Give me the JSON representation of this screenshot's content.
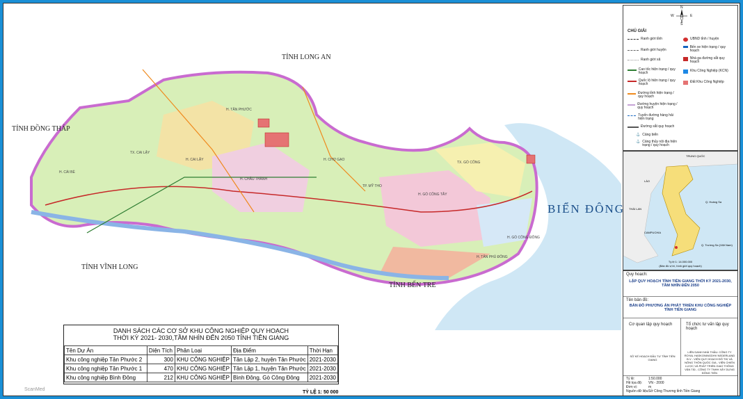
{
  "map": {
    "sea_label": "BIỂN ĐÔNG",
    "neighbors": [
      {
        "id": "long-an",
        "text": "TỈNH LONG AN"
      },
      {
        "id": "dong-thap",
        "text": "TỈNH ĐỒNG THÁP"
      },
      {
        "id": "vinh-long",
        "text": "TỈNH VĨNH LONG"
      },
      {
        "id": "ben-tre",
        "text": "TỈNH BẾN TRE"
      }
    ],
    "districts": [
      "H. CÁI BÈ",
      "H. CAI LẬY",
      "H. TÂN PHƯỚC",
      "TX. CAI LẬY",
      "H. CHÂU THÀNH",
      "TP. MỸ THO",
      "H. CHỢ GẠO",
      "H. GÒ CÔNG TÂY",
      "H. GÒ CÔNG ĐÔNG",
      "TX. GÒ CÔNG",
      "H. TÂN PHÚ ĐÔNG"
    ],
    "scale": "TỶ LỆ 1: 50 000",
    "watermark": "ScanMed"
  },
  "legend": {
    "compass": {
      "n": "N",
      "s": "S",
      "e": "E",
      "w": "W"
    },
    "title": "CHÚ GIẢI",
    "left_items": [
      {
        "id": "ranh-gioi-tinh",
        "label": "Ranh giới tỉnh",
        "color": "#333",
        "style": "dashed"
      },
      {
        "id": "ranh-gioi-huyen",
        "label": "Ranh giới huyện",
        "color": "#666",
        "style": "dashed"
      },
      {
        "id": "ranh-gioi-xa",
        "label": "Ranh giới xã",
        "color": "#999",
        "style": "dotted"
      },
      {
        "id": "cao-toc",
        "label": "Cao tốc hiện trạng / quy hoạch",
        "color": "#2e7d32",
        "style": "solid"
      },
      {
        "id": "quoc-lo",
        "label": "Quốc lộ hiện trạng / quy hoạch",
        "color": "#c62828",
        "style": "solid"
      },
      {
        "id": "duong-tinh",
        "label": "Đường tỉnh hiện trạng / quy hoạch",
        "color": "#ef8a1e",
        "style": "solid"
      },
      {
        "id": "duong-huyen",
        "label": "Đường huyện hiện trạng / quy hoạch",
        "color": "#c5a3d6",
        "style": "solid"
      },
      {
        "id": "hang-hai",
        "label": "Tuyến đường hàng hải hiện trạng",
        "color": "#1565c0",
        "style": "dashed"
      },
      {
        "id": "duong-sat",
        "label": "Đường sắt quy hoạch",
        "color": "#555",
        "style": "solid"
      }
    ],
    "bottom_items": [
      {
        "id": "cang-bien",
        "label": "Cảng biển"
      },
      {
        "id": "cang-thuy",
        "label": "Cảng thủy nội địa hiện trạng / quy hoạch"
      }
    ],
    "right_items": [
      {
        "id": "ubnd",
        "label": "UBND tỉnh / huyện",
        "color": "#d32f2f"
      },
      {
        "id": "ben-xe",
        "label": "Bến xe hiện trạng / quy hoạch",
        "color": "#1565c0"
      },
      {
        "id": "nha-ga",
        "label": "Nhà ga đường sắt quy hoạch",
        "color": "#c62828"
      },
      {
        "id": "kcn",
        "label": "Khu Công Nghiệp (KCN)",
        "color": "#1e88e5"
      },
      {
        "id": "dat-kcn",
        "label": "Đất Khu Công Nghiệp",
        "color": "#e57373"
      }
    ]
  },
  "inset": {
    "labels": [
      "TRUNG QUỐC",
      "LÀO",
      "THÁI LAN",
      "CAMPUCHIA",
      "Q. Hoàng Sa",
      "Q. Trường Sa (Việt Nam)"
    ],
    "caption1": "Tỷ lệ 1: 14.000.000",
    "caption2": "(Bản đồ vị trí, hình giới quy hoạch)"
  },
  "info": {
    "quy_hoach_label": "Quy hoạch:",
    "quy_hoach_title": "LẬP QUY HOẠCH TỈNH TIỀN GIANG THỜI KỲ 2021-2030, TẦM NHÌN ĐẾN 2050",
    "ten_ban_do_label": "Tên bản đồ:",
    "ten_ban_do": "BẢN ĐỒ PHƯƠNG ÁN PHÁT TRIỂN KHU CÔNG NGHIỆP TỈNH TIỀN GIANG",
    "co_quan_label": "Cơ quan lập quy hoạch",
    "to_chuc_label": "Tổ chức tư vấn lập quy hoạch",
    "co_quan_value": "SỞ KẾ HOẠCH ĐẦU TƯ TỈNH TIỀN GIANG",
    "to_chuc_value": "LIÊN DANH NHÀ THẦU: CÔNG TY ROYAL HASKONINGDHV NEDERLAND B.V - VIỆN QUY HOẠCH ĐÔ THỊ VÀ NÔNG THÔN QUỐC GIA - VIỆN CHIẾN LƯỢC VÀ PHÁT TRIỂN GIAO THÔNG VẬN TẢI - CÔNG TY TNHH XÂY DỰNG ĐÔNG TIẾN",
    "ty_le_k": "Tỷ lệ:",
    "ty_le_v": "1:50.000",
    "he_toa_do_k": "Hệ tọa độ:",
    "he_toa_do_v": "VN - 2000",
    "don_vi_k": "Đơn vị:",
    "don_vi_v": "m",
    "nguon_k": "Nguồn dữ liệu:",
    "nguon_v": "Sở Công Thương tỉnh Tiền Giang"
  },
  "table": {
    "title_line1": "DANH SÁCH CÁC CƠ SỞ KHU CÔNG NGHIỆP QUY HOẠCH",
    "title_line2": "THỜI KỲ 2021- 2030,TẦM NHÌN ĐẾN 2050 TỈNH TIỀN GIANG",
    "headers": [
      "Tên Dự Án",
      "Diện Tích",
      "Phân Loại",
      "Địa Điểm",
      "Thời Hạn"
    ],
    "rows": [
      [
        "Khu công nghiệp Tân Phước 2",
        "300",
        "KHU CÔNG NGHIỆP",
        "Tân Lập 2, huyện Tân Phước",
        "2021-2030"
      ],
      [
        "Khu công nghiệp Tân Phước 1",
        "470",
        "KHU CÔNG NGHIỆP",
        "Tân Lập 1, huyện Tân Phước",
        "2021-2030"
      ],
      [
        "Khu công nghiệp Bình Đông",
        "212",
        "KHU CÔNG NGHIỆP",
        "Bình Đông, Gò Công Đông",
        "2021-2030"
      ]
    ]
  }
}
